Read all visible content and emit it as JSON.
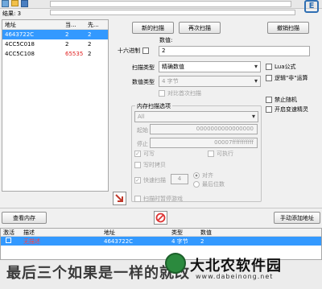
{
  "top": {
    "results_label": "结果: 3",
    "progress": 0
  },
  "results": {
    "columns": [
      "地址",
      "当...",
      "先..."
    ],
    "rows": [
      {
        "address": "4643722C",
        "current": "2",
        "previous": "2",
        "selected": true,
        "changed": false
      },
      {
        "address": "4CC5C018",
        "current": "2",
        "previous": "2",
        "selected": false,
        "changed": false
      },
      {
        "address": "4CC5C108",
        "current": "65535",
        "previous": "2",
        "selected": false,
        "changed": true
      }
    ]
  },
  "scan": {
    "new_scan": "新的扫描",
    "next_scan": "再次扫描",
    "undo_scan": "撤销扫描",
    "value_label": "数值:",
    "hex_label": "十六进制",
    "value": "2",
    "scan_type_label": "扫描类型",
    "scan_type": "精确数值",
    "value_type_label": "数值类型",
    "value_type": "4 字节",
    "compare_first": "对比首次扫描",
    "memory_options_label": "内存扫描选项",
    "memory_region": "All",
    "start_label": "起始",
    "start_value": "0000000000000000",
    "stop_label": "停止",
    "stop_value": "00007fffffffffff",
    "writable": "可写",
    "executable": "可执行",
    "copy_on_write": "写时拷贝",
    "fast_scan": "快速扫描",
    "fast_scan_value": "4",
    "alignment": "对齐",
    "last_digits": "最后位数",
    "pause_game": "扫描时暂停游戏",
    "lua_formula": "Lua公式",
    "not_logic": "逻辑\"非\"运算",
    "disable_random": "禁止随机",
    "speedhack": "开启变速精灵"
  },
  "bottom": {
    "view_memory": "查看内存",
    "add_address": "手动添加地址"
  },
  "address_list": {
    "columns": [
      "激活",
      "描述",
      "地址",
      "类型",
      "数值"
    ],
    "rows": [
      {
        "active": false,
        "description": "无描述",
        "address": "4643722C",
        "type": "4 字节",
        "value": "2"
      }
    ]
  },
  "caption": {
    "text": "最后三个如果是一样的就改",
    "watermark": "大北农软件园",
    "watermark_url": "www.dabeinong.net"
  }
}
